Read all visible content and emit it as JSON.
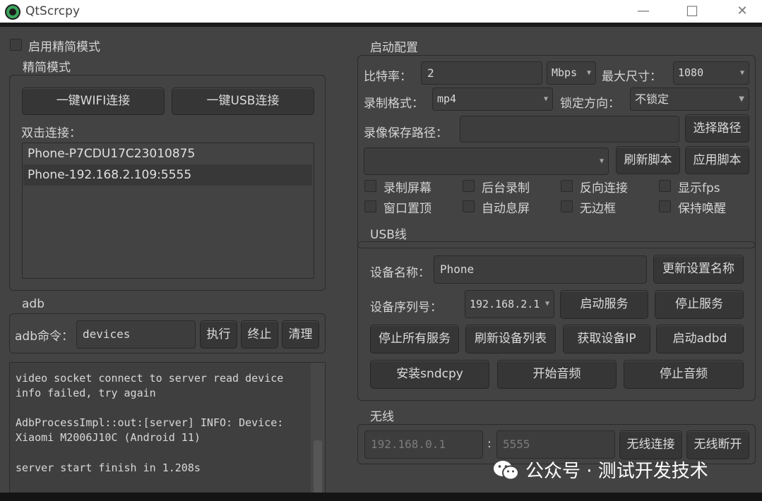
{
  "window": {
    "title": "QtScrcpy",
    "minimize": "—",
    "maximize": "☐",
    "close": "✕"
  },
  "simple_mode": {
    "checkbox_label": "启用精简模式",
    "group_title": "精简模式",
    "wifi_button": "一键WIFI连接",
    "usb_button": "一键USB连接",
    "double_click_label": "双击连接：",
    "devices": [
      "Phone-P7CDU17C23010875",
      "Phone-192.168.2.109:5555"
    ]
  },
  "adb": {
    "group_title": "adb",
    "command_label": "adb命令：",
    "command_value": "devices",
    "execute": "执行",
    "terminate": "终止",
    "clear": "清理"
  },
  "log": {
    "lines": [
      "video socket connect to server read device",
      "info failed, try again",
      "",
      "AdbProcessImpl::out:[server] INFO: Device:",
      "Xiaomi M2006J10C (Android 11)",
      "",
      "server start finish in 1.208s"
    ]
  },
  "config": {
    "group_title": "启动配置",
    "bitrate_label": "比特率：",
    "bitrate_value": "2",
    "bitrate_unit": "Mbps",
    "max_size_label": "最大尺寸：",
    "max_size_value": "1080",
    "record_format_label": "录制格式：",
    "record_format_value": "mp4",
    "lock_orientation_label": "锁定方向：",
    "lock_orientation_value": "不锁定",
    "save_path_label": "录像保存路径：",
    "save_path_value": "",
    "select_path": "选择路径",
    "script_value": "",
    "refresh_script": "刷新脚本",
    "apply_script": "应用脚本",
    "checkboxes": [
      "录制屏幕",
      "后台录制",
      "反向连接",
      "显示fps",
      "窗口置顶",
      "自动息屏",
      "无边框",
      "保持唤醒"
    ]
  },
  "usb": {
    "group_title": "USB线",
    "device_name_label": "设备名称：",
    "device_name_value": "Phone",
    "update_name": "更新设置名称",
    "serial_label": "设备序列号：",
    "serial_value": "192.168.2.1",
    "start_server": "启动服务",
    "stop_server": "停止服务",
    "stop_all": "停止所有服务",
    "refresh_devices": "刷新设备列表",
    "get_ip": "获取设备IP",
    "start_adbd": "启动adbd",
    "install_sndcpy": "安装sndcpy",
    "start_audio": "开始音频",
    "stop_audio": "停止音频"
  },
  "wireless": {
    "group_title": "无线",
    "ip_placeholder": "192.168.0.1",
    "separator": ":",
    "port_placeholder": "5555",
    "connect": "无线连接",
    "disconnect": "无线断开"
  },
  "watermark": {
    "text": "公众号 · 测试开发技术"
  },
  "colors": {
    "window_bg": "#434343",
    "titlebar_bg": "#ffffff",
    "app_icon": "#3ba55d"
  }
}
